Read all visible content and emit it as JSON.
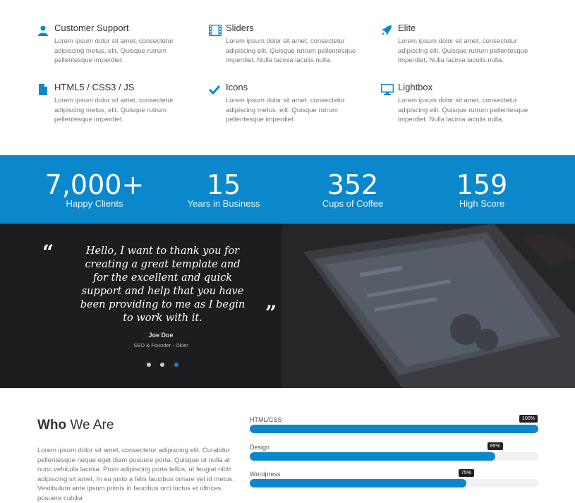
{
  "features": [
    {
      "title": "Customer Support",
      "text": "Lorem ipsum dolor sit amet, consectetur adipiscing metus, elit. Quisque rutrum pellentesque imperdiet.",
      "icon": "user-icon"
    },
    {
      "title": "Sliders",
      "text": "Lorem ipsum dolor sit amet, consectetur adipiscing elit. Quisque rutrum pellentesque imperdiet. Nulla lacinia iaculis nulla.",
      "icon": "film-icon"
    },
    {
      "title": "Elite",
      "text": "Lorem ipsum dolor sit amet, consectetur adipiscing elit. Quisque rutrum pellentesque imperdiet. Nulla lacinia iaculis nulla.",
      "icon": "rocket-icon"
    },
    {
      "title": "HTML5 / CSS3 / JS",
      "text": "Lorem ipsum dolor sit amet, consectetur adipiscing metus, elit. Quisque rutrum pellentesque imperdiet.",
      "icon": "file-icon"
    },
    {
      "title": "Icons",
      "text": "Lorem ipsum dolor sit amet, consectetur adipiscing metus. elit. Quisque rutrum pellentesque imperdiet.",
      "icon": "check-icon"
    },
    {
      "title": "Lightbox",
      "text": "Lorem ipsum dolor sit amet, consectetur adipiscing elit. Quisque rutrum pellentesque imperdiet. Nulla lacinia iaculis nulla.",
      "icon": "desktop-icon"
    }
  ],
  "stats": [
    {
      "number": "7,000+",
      "label": "Happy Clients"
    },
    {
      "number": "15",
      "label": "Years in Business"
    },
    {
      "number": "352",
      "label": "Cups of Coffee"
    },
    {
      "number": "159",
      "label": "High Score"
    }
  ],
  "testimonial": {
    "quote": "Hello, I want to thank you for creating a great template and for the excellent and quick support and help that you have been providing to me as I begin to work with it.",
    "author": "Joe Doe",
    "role": "SEO & Founder - Okler",
    "open_mark": "“",
    "close_mark": "”",
    "active_dot": 3
  },
  "who": {
    "title_bold": "Who",
    "title_rest": "We Are",
    "text": "Lorem ipsum dolor sit amet, consectetur adipiscing elit. Curabitur pellentesque neque eget diam posuere porta. Quisque ut nulla at nunc vehicula lacinia. Proin adipiscing porta tellus, ut feugiat nibh adipiscing sit amet. In eu justo a felis faucibus ornare vel id metus. Vestibulum ante ipsum primis in faucibus orci luctus et ultrices posuere cubilia"
  },
  "skills": [
    {
      "label": "HTML/CSS",
      "value": "100%",
      "fraction": 1.0
    },
    {
      "label": "Design",
      "value": "85%",
      "fraction": 0.85
    },
    {
      "label": "Wordpress",
      "value": "75%",
      "fraction": 0.75
    }
  ],
  "colors": {
    "accent": "#0b88cc",
    "dark": "#1d1d1f"
  }
}
